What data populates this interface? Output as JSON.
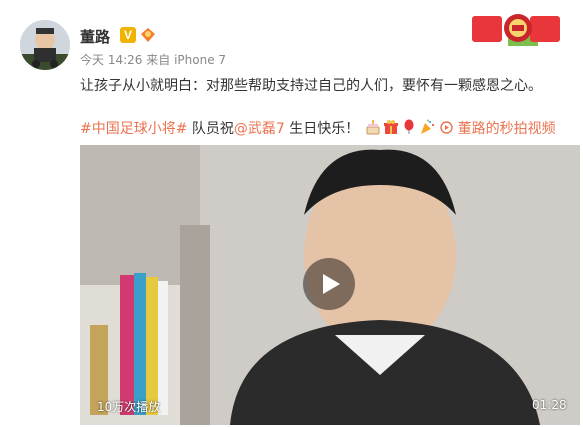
{
  "post": {
    "username": "董路",
    "time": "今天 14:26",
    "source_prefix": "来自",
    "source": "iPhone 7",
    "text_line1": "让孩子从小就明白：对那些帮助支持过自己的人们，要怀有一颗感恩之心。",
    "hashtag": "#中国足球小将#",
    "text_mid": " 队员祝",
    "mention": "@武磊7",
    "text_end": " 生日快乐！",
    "video_link_label": "董路的秒拍视频"
  },
  "video": {
    "view_count": "10万次播放",
    "duration": "01:28"
  },
  "colors": {
    "accent": "#eb7350",
    "v_badge": "#f0b400"
  },
  "icons": {
    "verified": "v-badge-icon",
    "member": "member-badge-icon",
    "cake": "cake-emoji-icon",
    "gift": "gift-emoji-icon",
    "balloon": "balloon-emoji-icon",
    "party": "party-emoji-icon",
    "video_link": "video-link-icon",
    "play": "play-icon"
  }
}
